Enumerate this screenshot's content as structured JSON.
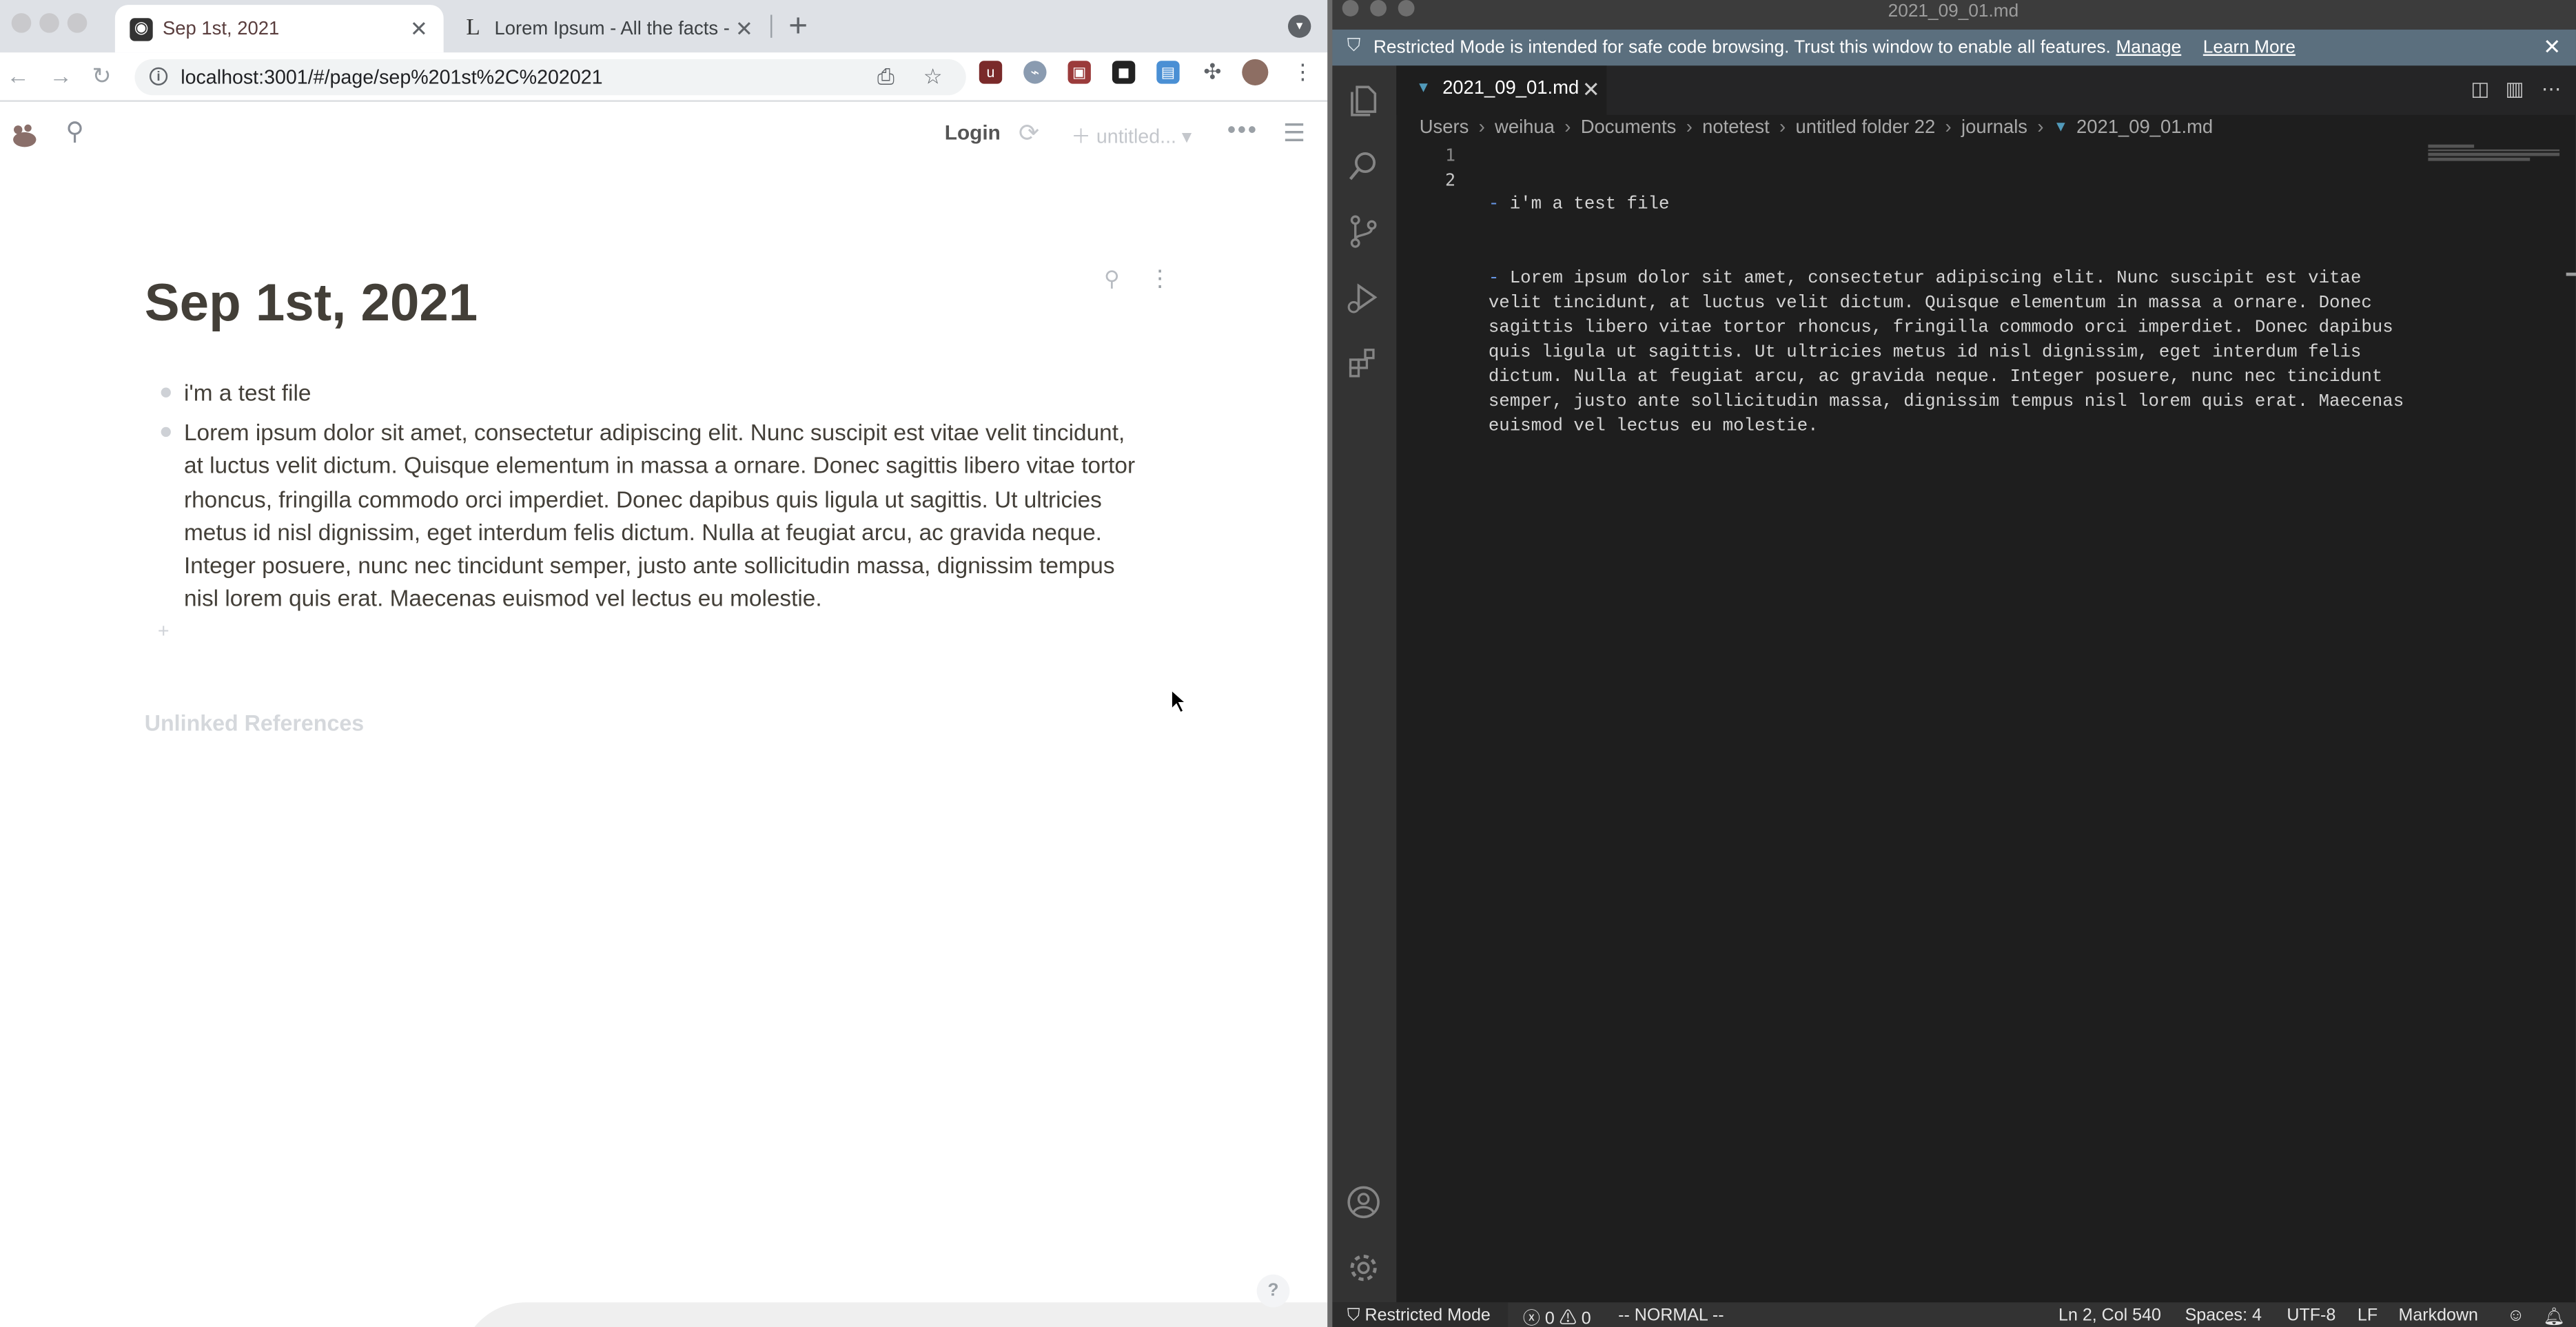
{
  "browser": {
    "tabs": [
      {
        "title": "Sep 1st, 2021",
        "active": true
      },
      {
        "title": "Lorem Ipsum - All the facts - Li",
        "active": false
      }
    ],
    "new_tab_symbol": "+",
    "url": "localhost:3001/#/page/sep%201st%2C%202021",
    "nav_icons": [
      "back-icon",
      "forward-icon",
      "reload-icon"
    ],
    "extensions": [
      "ublock-icon",
      "extension-icon",
      "extension-icon",
      "extension-icon",
      "extension-icon",
      "puzzle-icon"
    ]
  },
  "app": {
    "header": {
      "login_label": "Login",
      "graph_label": "untitled..."
    },
    "page": {
      "title": "Sep 1st, 2021",
      "blocks": [
        "i'm a test file",
        "Lorem ipsum dolor sit amet, consectetur adipiscing elit. Nunc suscipit est vitae velit tincidunt, at luctus velit dictum. Quisque elementum in massa a ornare. Donec sagittis libero vitae tortor rhoncus, fringilla commodo orci imperdiet. Donec dapibus quis ligula ut sagittis. Ut ultricies metus id nisl dignissim, eget interdum felis dictum. Nulla at feugiat arcu, ac gravida neque. Integer posuere, nunc nec tincidunt semper, justo ante sollicitudin massa, dignissim tempus nisl lorem quis erat. Maecenas euismod vel lectus eu molestie."
      ],
      "add_block_symbol": "+",
      "unlinked_references": "Unlinked References"
    },
    "help_label": "?"
  },
  "vscode": {
    "window_title": "2021_09_01.md",
    "banner": {
      "message": "Restricted Mode is intended for safe code browsing. Trust this window to enable all features.",
      "manage": "Manage",
      "learn_more": "Learn More"
    },
    "tab": {
      "label": "2021_09_01.md"
    },
    "breadcrumb": [
      "Users",
      "weihua",
      "Documents",
      "notetest",
      "untitled folder 22",
      "journals",
      "2021_09_01.md"
    ],
    "lines": [
      {
        "number": "1",
        "text": "i'm a test file"
      },
      {
        "number": "2",
        "text": "Lorem ipsum dolor sit amet, consectetur adipiscing elit. Nunc suscipit est vitae velit tincidunt, at luctus velit dictum. Quisque elementum in massa a ornare. Donec sagittis libero vitae tortor rhoncus, fringilla commodo orci imperdiet. Donec dapibus quis ligula ut sagittis. Ut ultricies metus id nisl dignissim, eget interdum felis dictum. Nulla at feugiat arcu, ac gravida neque. Integer posuere, nunc nec tincidunt semper, justo ante sollicitudin massa, dignissim tempus nisl lorem quis erat. Maecenas euismod vel lectus eu molestie."
      }
    ],
    "activity_icons": [
      "files-icon",
      "search-icon",
      "source-control-icon",
      "run-debug-icon",
      "extensions-icon",
      "account-icon",
      "settings-gear-icon"
    ],
    "status": {
      "restricted": "Restricted Mode",
      "problems": "0",
      "warnings": "0",
      "vim_mode": "-- NORMAL --",
      "position": "Ln 2, Col 540",
      "spaces": "Spaces: 4",
      "encoding": "UTF-8",
      "eol": "LF",
      "language": "Markdown"
    },
    "colors": {
      "banner": "#5b6f7e",
      "editor_bg": "#1e1e1e",
      "activity_bg": "#333333"
    }
  }
}
